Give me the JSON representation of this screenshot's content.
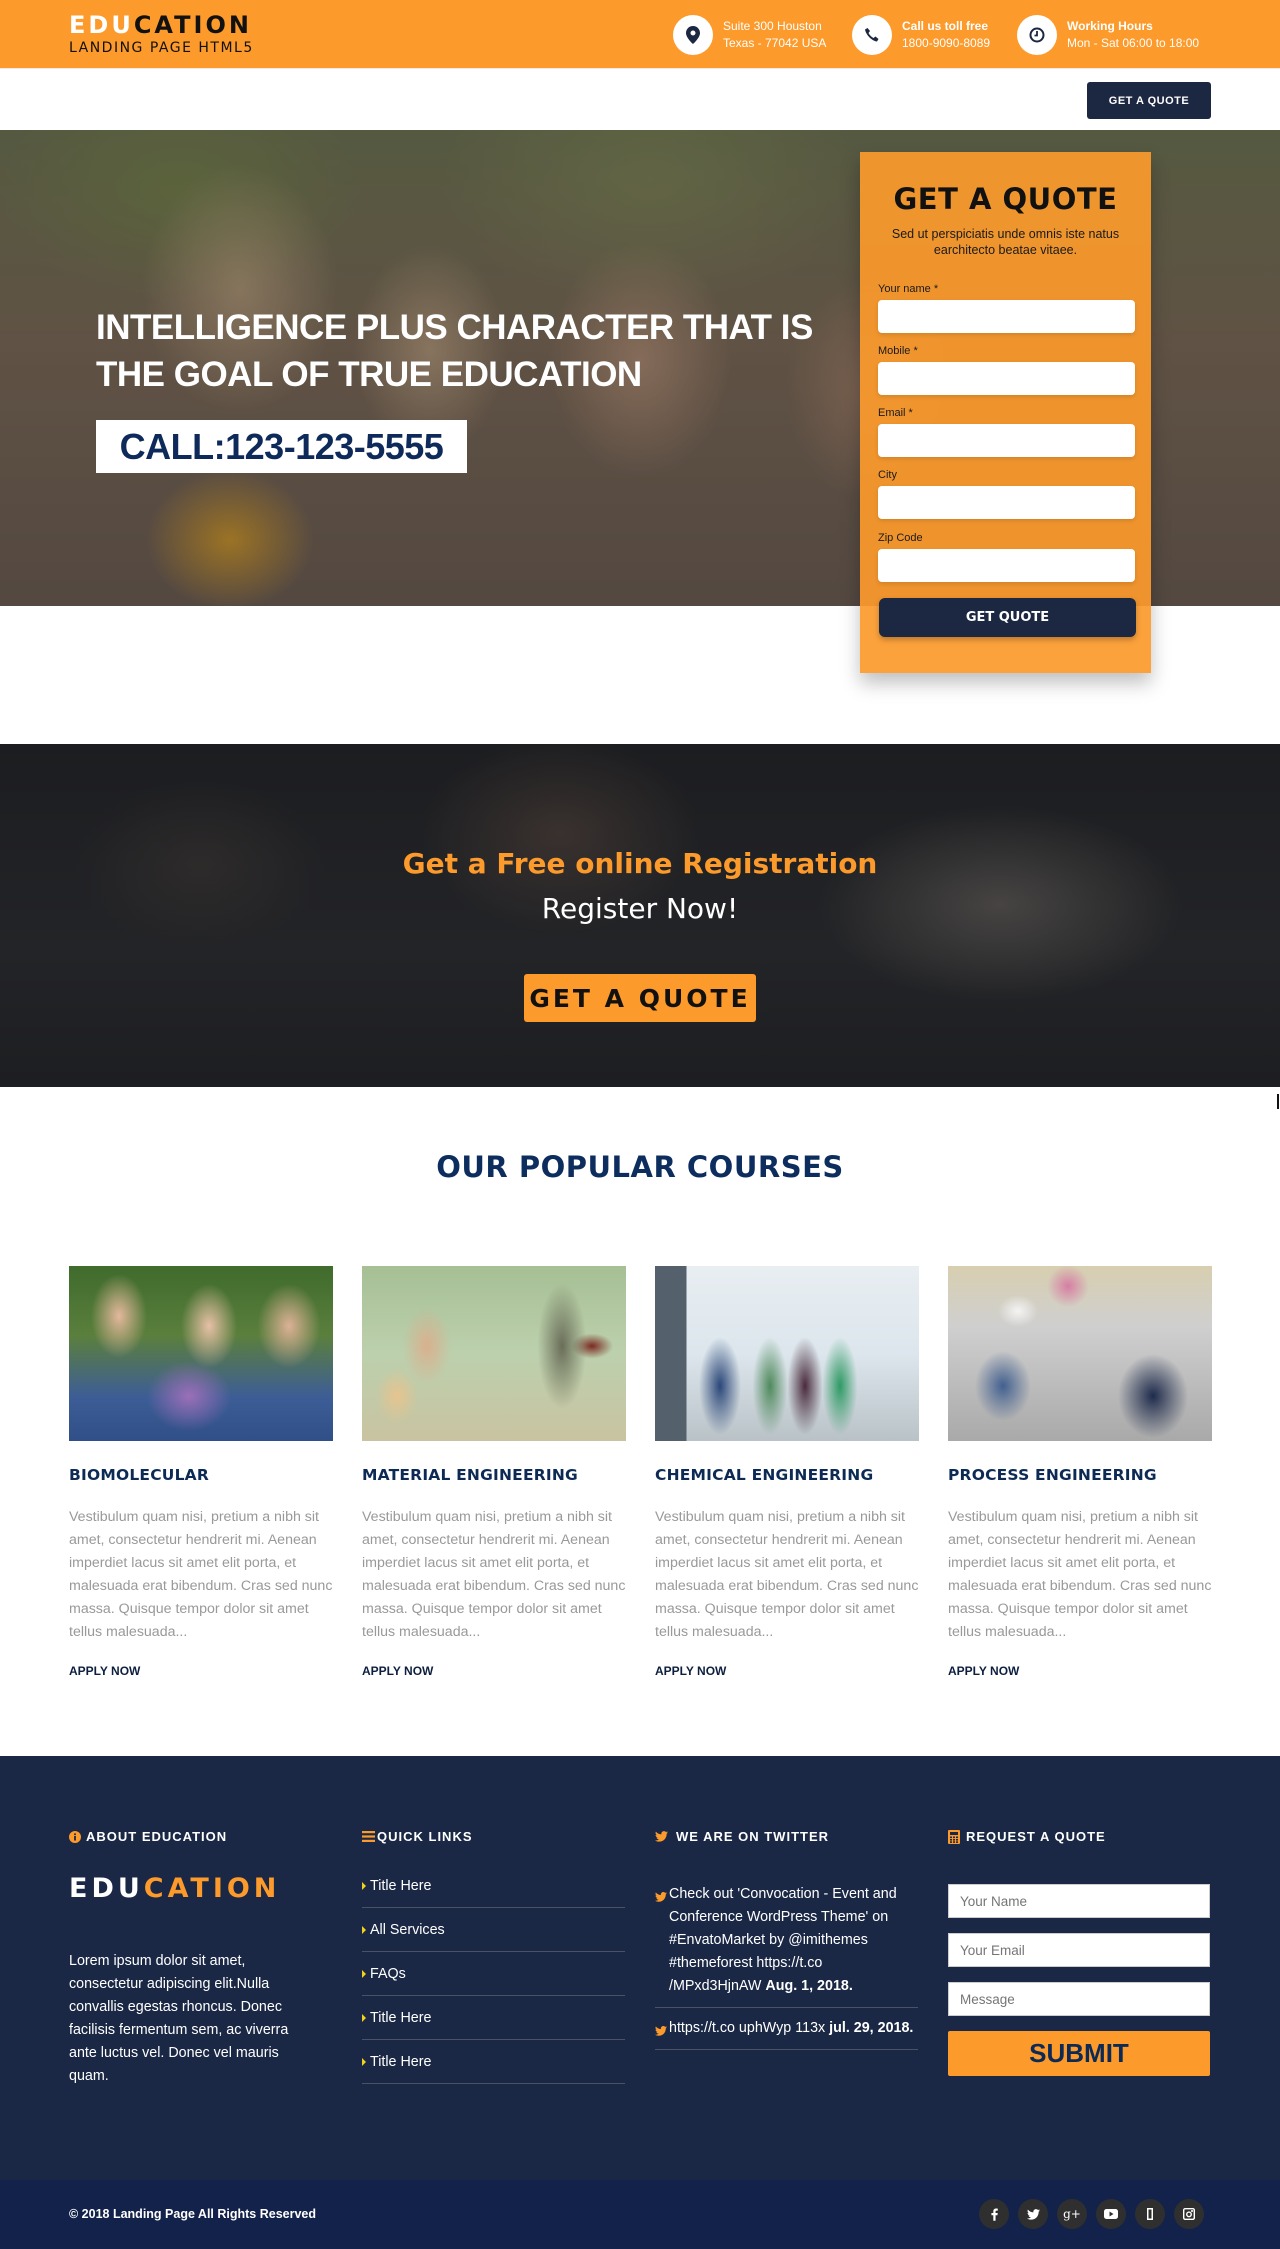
{
  "brand": {
    "logo_part1": "EDU",
    "logo_part2": "CATION",
    "tagline": "LANDING PAGE HTML5"
  },
  "colors": {
    "accent": "#fc9a2b",
    "navy": "#1c2742",
    "footer_bg": "#1b2845",
    "bottom_bar": "#13224a",
    "heading_blue": "#0c2d5e"
  },
  "contacts": [
    {
      "icon": "map-pin-icon",
      "line1": "Suite 300 Houston",
      "line2": "Texas - 77042 USA"
    },
    {
      "icon": "phone-icon",
      "line1": "Call us toll free",
      "line2": "1800-9090-8089"
    },
    {
      "icon": "clock-icon",
      "line1": "Working Hours",
      "line2": "Mon - Sat 06:00 to 18:00"
    }
  ],
  "nav": {
    "social": [
      "facebook-icon",
      "twitter-icon",
      "youtube-icon",
      "instagram-icon"
    ],
    "quote_button": "GET A QUOTE"
  },
  "hero": {
    "headline": "INTELLIGENCE PLUS CHARACTER THAT IS THE GOAL OF TRUE EDUCATION",
    "call": "CALL:123-123-5555"
  },
  "quote_form": {
    "title": "GET A QUOTE",
    "description": "Sed ut perspiciatis unde omnis iste natus earchitecto beatae vitaee.",
    "fields": [
      {
        "label": "Your name *",
        "value": ""
      },
      {
        "label": "Mobile *",
        "value": ""
      },
      {
        "label": "Email *",
        "value": ""
      },
      {
        "label": "City",
        "value": ""
      },
      {
        "label": "Zip Code",
        "value": ""
      }
    ],
    "submit": "GET QUOTE"
  },
  "registration": {
    "title": "Get a Free online Registration",
    "subtitle": "Register Now!",
    "button": "GET A QUOTE"
  },
  "courses": {
    "title": "OUR POPULAR COURSES",
    "items": [
      {
        "name": "BIOMOLECULAR",
        "description": "Vestibulum quam nisi, pretium a nibh sit amet, consectetur hendrerit mi. Aenean imperdiet lacus sit amet elit porta, et malesuada erat bibendum. Cras sed nunc massa. Quisque tempor dolor sit amet tellus malesuada...",
        "link": "APPLY NOW"
      },
      {
        "name": "MATERIAL ENGINEERING",
        "description": "Vestibulum quam nisi, pretium a nibh sit amet, consectetur hendrerit mi. Aenean imperdiet lacus sit amet elit porta, et malesuada erat bibendum. Cras sed nunc massa. Quisque tempor dolor sit amet tellus malesuada...",
        "link": "APPLY NOW"
      },
      {
        "name": "CHEMICAL ENGINEERING",
        "description": "Vestibulum quam nisi, pretium a nibh sit amet, consectetur hendrerit mi. Aenean imperdiet lacus sit amet elit porta, et malesuada erat bibendum. Cras sed nunc massa. Quisque tempor dolor sit amet tellus malesuada...",
        "link": "APPLY NOW"
      },
      {
        "name": "PROCESS ENGINEERING",
        "description": "Vestibulum quam nisi, pretium a nibh sit amet, consectetur hendrerit mi. Aenean imperdiet lacus sit amet elit porta, et malesuada erat bibendum. Cras sed nunc massa. Quisque tempor dolor sit amet tellus malesuada...",
        "link": "APPLY NOW"
      }
    ]
  },
  "footer": {
    "about": {
      "heading": "ABOUT EDUCATION",
      "logo_part1": "EDU",
      "logo_part2": "CATION",
      "text": "Lorem ipsum dolor sit amet, consectetur adipiscing elit.Nulla convallis egestas rhoncus. Donec facilisis fermentum sem, ac viverra ante luctus vel. Donec vel mauris quam."
    },
    "quick_links": {
      "heading": "QUICK LINKS",
      "items": [
        "Title Here",
        "All Services",
        "FAQs",
        "Title Here",
        "Title Here"
      ]
    },
    "twitter": {
      "heading": "WE ARE ON TWITTER",
      "tweets": [
        {
          "text": "Check out 'Convocation - Event and Conference WordPress Theme' on #EnvatoMarket by @imithemes #themeforest https://t.co /MPxd3HjnAW",
          "date": "Aug. 1, 2018."
        },
        {
          "text": "https://t.co uphWyp 113x",
          "date": "jul. 29, 2018."
        }
      ]
    },
    "request": {
      "heading": "REQUEST A QUOTE",
      "name_placeholder": "Your Name",
      "email_placeholder": "Your Email",
      "message_placeholder": "Message",
      "submit": "SUBMIT"
    },
    "copyright": "© 2018 Landing Page All Rights Reserved",
    "social": [
      "facebook-icon",
      "twitter-icon",
      "google-plus-icon",
      "youtube-icon",
      "unknown-icon",
      "instagram-icon"
    ]
  }
}
